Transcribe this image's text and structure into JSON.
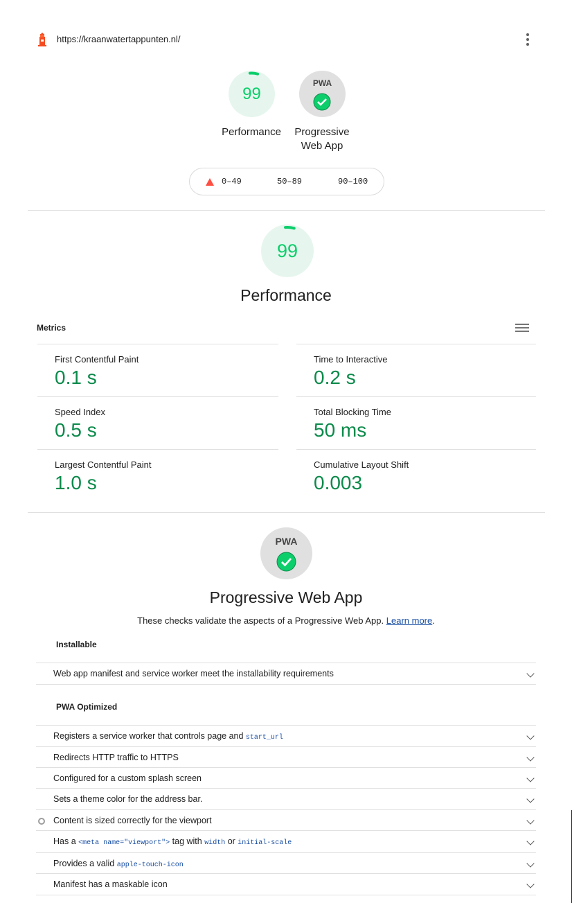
{
  "topbar": {
    "url": "https://kraanwatertappunten.nl/",
    "logo_icon": "lighthouse-icon",
    "menu_icon": "more-vert-icon"
  },
  "summary": {
    "gauges": [
      {
        "label": "Performance",
        "score": "99"
      },
      {
        "label_line1": "Progressive",
        "label_line2": "Web App",
        "badge": "PWA"
      }
    ],
    "legend": {
      "fail": "0–49",
      "average": "50–89",
      "pass": "90–100"
    }
  },
  "performance": {
    "score": "99",
    "score_fraction": 0.99,
    "title": "Performance",
    "metrics_header": "Metrics",
    "metrics": [
      {
        "label": "First Contentful Paint",
        "value": "0.1 s"
      },
      {
        "label": "Time to Interactive",
        "value": "0.2 s"
      },
      {
        "label": "Speed Index",
        "value": "0.5 s"
      },
      {
        "label": "Total Blocking Time",
        "value": "50 ms"
      },
      {
        "label": "Largest Contentful Paint",
        "value": "1.0 s"
      },
      {
        "label": "Cumulative Layout Shift",
        "value": "0.003"
      }
    ]
  },
  "pwa": {
    "badge": "PWA",
    "title": "Progressive Web App",
    "description": "These checks validate the aspects of a Progressive Web App.",
    "learn_more": "Learn more",
    "period": ".",
    "groups": [
      {
        "title": "Installable"
      },
      {
        "title": "PWA Optimized"
      }
    ],
    "installable_audits": [
      {
        "text": "Web app manifest and service worker meet the installability requirements"
      }
    ],
    "optimized_audits": [
      {
        "text": "Registers a service worker that controls page and ",
        "code": "start_url"
      },
      {
        "text": "Redirects HTTP traffic to HTTPS"
      },
      {
        "text": "Configured for a custom splash screen"
      },
      {
        "text": "Sets a theme color for the address bar."
      },
      {
        "text": "Content is sized correctly for the viewport"
      },
      {
        "pre": "Has a ",
        "code1": "<meta name=\"viewport\">",
        "mid": " tag with ",
        "code2": "width",
        "mid2": " or ",
        "code3": "initial-scale"
      },
      {
        "text": "Provides a valid ",
        "code": "apple-touch-icon"
      },
      {
        "text": "Manifest has a maskable icon"
      }
    ]
  },
  "colors": {
    "pass": "#0cce6b",
    "pass_text": "#0c8a4b",
    "average": "#ffa400",
    "fail": "#ff4e42",
    "link": "#1a4fa3"
  }
}
